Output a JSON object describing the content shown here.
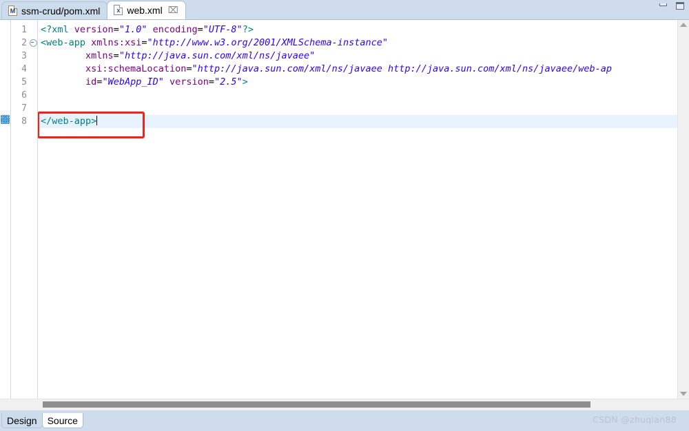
{
  "window": {
    "minimize_label": "Minimize",
    "maximize_label": "Maximize"
  },
  "editor_tabs": [
    {
      "label": "ssm-crud/pom.xml",
      "icon": "maven-file-icon",
      "icon_letter": "M",
      "active": false,
      "closable": false
    },
    {
      "label": "web.xml",
      "icon": "xml-file-icon",
      "icon_letter": "x",
      "active": true,
      "closable": true,
      "close_glyph": "⌧"
    }
  ],
  "editor": {
    "line_numbers": [
      "1",
      "2",
      "3",
      "4",
      "5",
      "6",
      "7",
      "8"
    ],
    "current_line": 8,
    "fold_line": 2,
    "annotation_marker_line": 8,
    "lines": [
      {
        "n": 1,
        "tokens": [
          {
            "t": "<?xml",
            "c": "proc"
          },
          {
            "t": " ",
            "c": "punct"
          },
          {
            "t": "version",
            "c": "attr"
          },
          {
            "t": "=",
            "c": "punct"
          },
          {
            "t": "\"1.0\"",
            "c": "val"
          },
          {
            "t": " ",
            "c": "punct"
          },
          {
            "t": "encoding",
            "c": "attr"
          },
          {
            "t": "=",
            "c": "punct"
          },
          {
            "t": "\"UTF-8\"",
            "c": "val"
          },
          {
            "t": "?>",
            "c": "proc"
          }
        ]
      },
      {
        "n": 2,
        "tokens": [
          {
            "t": "<web-app",
            "c": "tag"
          },
          {
            "t": " ",
            "c": "punct"
          },
          {
            "t": "xmlns:xsi",
            "c": "attr"
          },
          {
            "t": "=",
            "c": "punct"
          },
          {
            "t": "\"http://www.w3.org/2001/XMLSchema-instance\"",
            "c": "val"
          }
        ]
      },
      {
        "n": 3,
        "tokens": [
          {
            "t": "        ",
            "c": "punct"
          },
          {
            "t": "xmlns",
            "c": "attr"
          },
          {
            "t": "=",
            "c": "punct"
          },
          {
            "t": "\"http://java.sun.com/xml/ns/javaee\"",
            "c": "val"
          }
        ]
      },
      {
        "n": 4,
        "tokens": [
          {
            "t": "        ",
            "c": "punct"
          },
          {
            "t": "xsi:schemaLocation",
            "c": "attr"
          },
          {
            "t": "=",
            "c": "punct"
          },
          {
            "t": "\"http://java.sun.com/xml/ns/javaee http://java.sun.com/xml/ns/javaee/web-ap",
            "c": "val"
          }
        ]
      },
      {
        "n": 5,
        "tokens": [
          {
            "t": "        ",
            "c": "punct"
          },
          {
            "t": "id",
            "c": "attr"
          },
          {
            "t": "=",
            "c": "punct"
          },
          {
            "t": "\"WebApp_ID\"",
            "c": "val"
          },
          {
            "t": " ",
            "c": "punct"
          },
          {
            "t": "version",
            "c": "attr"
          },
          {
            "t": "=",
            "c": "punct"
          },
          {
            "t": "\"2.5\"",
            "c": "val"
          },
          {
            "t": ">",
            "c": "tag"
          }
        ]
      },
      {
        "n": 6,
        "tokens": []
      },
      {
        "n": 7,
        "tokens": []
      },
      {
        "n": 8,
        "tokens": [
          {
            "t": "</web-app>",
            "c": "tag"
          }
        ]
      }
    ]
  },
  "annotation": {
    "type": "red-rectangle-highlight",
    "color": "#f42212",
    "target_text": "</web-app>"
  },
  "scrollbars": {
    "vertical_up_label": "Scroll up",
    "vertical_down_label": "Scroll down",
    "horizontal_thumb_label": "Horizontal scroll thumb"
  },
  "bottom_tabs": [
    {
      "label": "Design",
      "active": false
    },
    {
      "label": "Source",
      "active": true
    }
  ],
  "watermark": "CSDN @zhuqian88",
  "colors": {
    "chrome": "#cfdcec",
    "tag": "#008080",
    "attribute": "#800080",
    "value": "#2a00ff",
    "current_line": "#e8f2fe",
    "annotation_red": "#f42212",
    "line_number": "#8c8c8c"
  }
}
